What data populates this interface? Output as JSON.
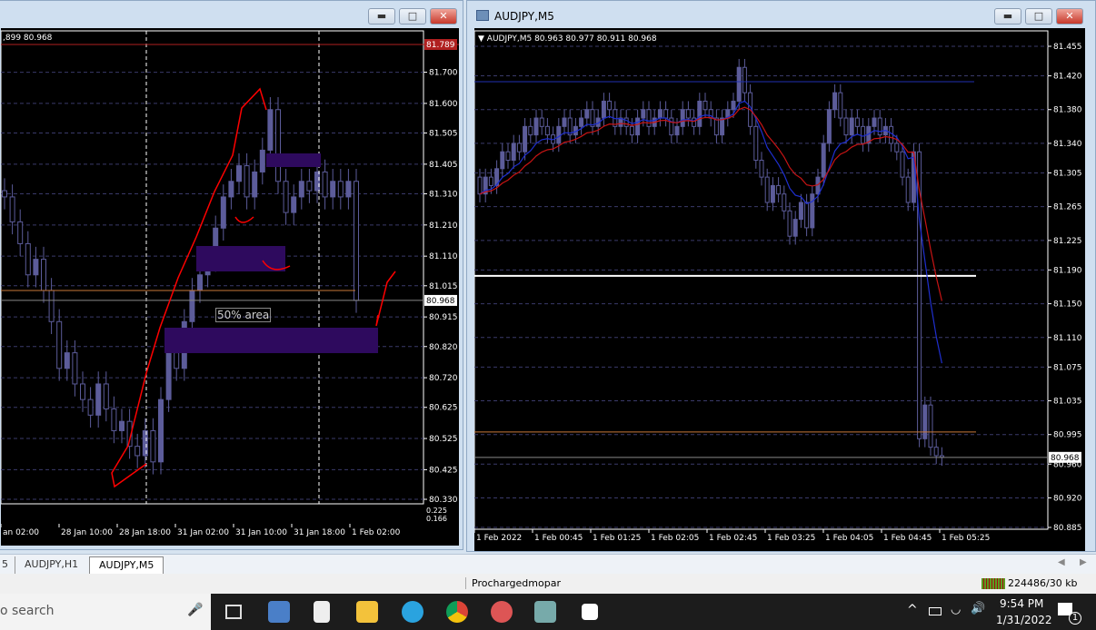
{
  "left_window": {
    "title": "",
    "ohlc_label": ",899 80.968",
    "price_ticks": [
      "81.700",
      "81.600",
      "81.505",
      "81.405",
      "81.310",
      "81.210",
      "81.110",
      "81.015",
      "80.915",
      "80.820",
      "80.720",
      "80.625",
      "80.525",
      "80.425",
      "80.330"
    ],
    "price_tick_values": [
      81.7,
      81.6,
      81.505,
      81.405,
      81.31,
      81.21,
      81.11,
      81.015,
      80.915,
      80.82,
      80.72,
      80.625,
      80.525,
      80.425,
      80.33
    ],
    "high_label": "81.789",
    "current_price": "80.968",
    "indicator_values": [
      "0.225",
      "0.166"
    ],
    "time_ticks": [
      "an 02:00",
      "28 Jan 10:00",
      "28 Jan 18:00",
      "31 Jan 02:00",
      "31 Jan 10:00",
      "31 Jan 18:00",
      "1 Feb 02:00"
    ],
    "annotation": "50% area",
    "closes": [
      81.3,
      81.22,
      81.15,
      81.05,
      81.1,
      81.0,
      80.9,
      80.75,
      80.8,
      80.7,
      80.65,
      80.6,
      80.7,
      80.62,
      80.55,
      80.58,
      80.5,
      80.47,
      80.55,
      80.45,
      80.65,
      80.8,
      80.75,
      80.9,
      81.0,
      81.05,
      81.1,
      81.2,
      81.3,
      81.35,
      81.4,
      81.3,
      81.38,
      81.45,
      81.58,
      81.35,
      81.25,
      81.3,
      81.35,
      81.32,
      81.38,
      81.3,
      81.35,
      81.3,
      81.35,
      80.968
    ],
    "lines": {
      "red_level": 81.789,
      "orange_level": 81.0,
      "current_level": 80.968
    }
  },
  "right_window": {
    "title": "AUDJPY,M5",
    "ohlc_label": "AUDJPY,M5  80.963 80.977 80.911 80.968",
    "price_ticks": [
      "81.455",
      "81.420",
      "81.380",
      "81.340",
      "81.305",
      "81.265",
      "81.225",
      "81.190",
      "81.150",
      "81.110",
      "81.075",
      "81.035",
      "80.995",
      "80.960",
      "80.920",
      "80.885"
    ],
    "price_tick_values": [
      81.455,
      81.42,
      81.38,
      81.34,
      81.305,
      81.265,
      81.225,
      81.19,
      81.15,
      81.11,
      81.075,
      81.035,
      80.995,
      80.96,
      80.92,
      80.885
    ],
    "current_price": "80.968",
    "time_ticks": [
      "1 Feb 2022",
      "1 Feb 00:45",
      "1 Feb 01:25",
      "1 Feb 02:05",
      "1 Feb 02:45",
      "1 Feb 03:25",
      "1 Feb 04:05",
      "1 Feb 04:45",
      "1 Feb 05:25"
    ],
    "closes": [
      81.28,
      81.3,
      81.29,
      81.31,
      81.33,
      81.32,
      81.34,
      81.33,
      81.36,
      81.35,
      81.37,
      81.36,
      81.35,
      81.34,
      81.36,
      81.37,
      81.35,
      81.36,
      81.37,
      81.38,
      81.36,
      81.37,
      81.39,
      81.38,
      81.36,
      81.37,
      81.36,
      81.35,
      81.37,
      81.38,
      81.36,
      81.37,
      81.38,
      81.37,
      81.35,
      81.36,
      81.38,
      81.37,
      81.36,
      81.39,
      81.38,
      81.37,
      81.35,
      81.37,
      81.38,
      81.39,
      81.43,
      81.4,
      81.36,
      81.32,
      81.3,
      81.27,
      81.29,
      81.28,
      81.26,
      81.23,
      81.25,
      81.27,
      81.24,
      81.28,
      81.3,
      81.34,
      81.38,
      81.4,
      81.37,
      81.35,
      81.37,
      81.36,
      81.34,
      81.36,
      81.37,
      81.35,
      81.36,
      81.34,
      81.33,
      81.3,
      81.27,
      81.33,
      80.99,
      81.03,
      80.98,
      80.97,
      80.968
    ],
    "lines": {
      "blue_level": 81.413,
      "white_level": 81.183,
      "orange_level": 80.998,
      "current_level": 80.968
    }
  },
  "tabs": [
    "5",
    "AUDJPY,H1",
    "AUDJPY,M5"
  ],
  "status": {
    "profile": "Prochargedmopar",
    "traffic": "224486/30 kb"
  },
  "taskbar": {
    "search_placeholder": "o search",
    "time": "9:54 PM",
    "date": "1/31/2022",
    "notifications": "1"
  },
  "colors": {
    "bg": "#000000",
    "candle": "#5c5c9a",
    "zone": "#2e0a5e",
    "drawing": "#ff0000",
    "ma_fast": "#1f2fd0",
    "ma_slow": "#c81414"
  }
}
